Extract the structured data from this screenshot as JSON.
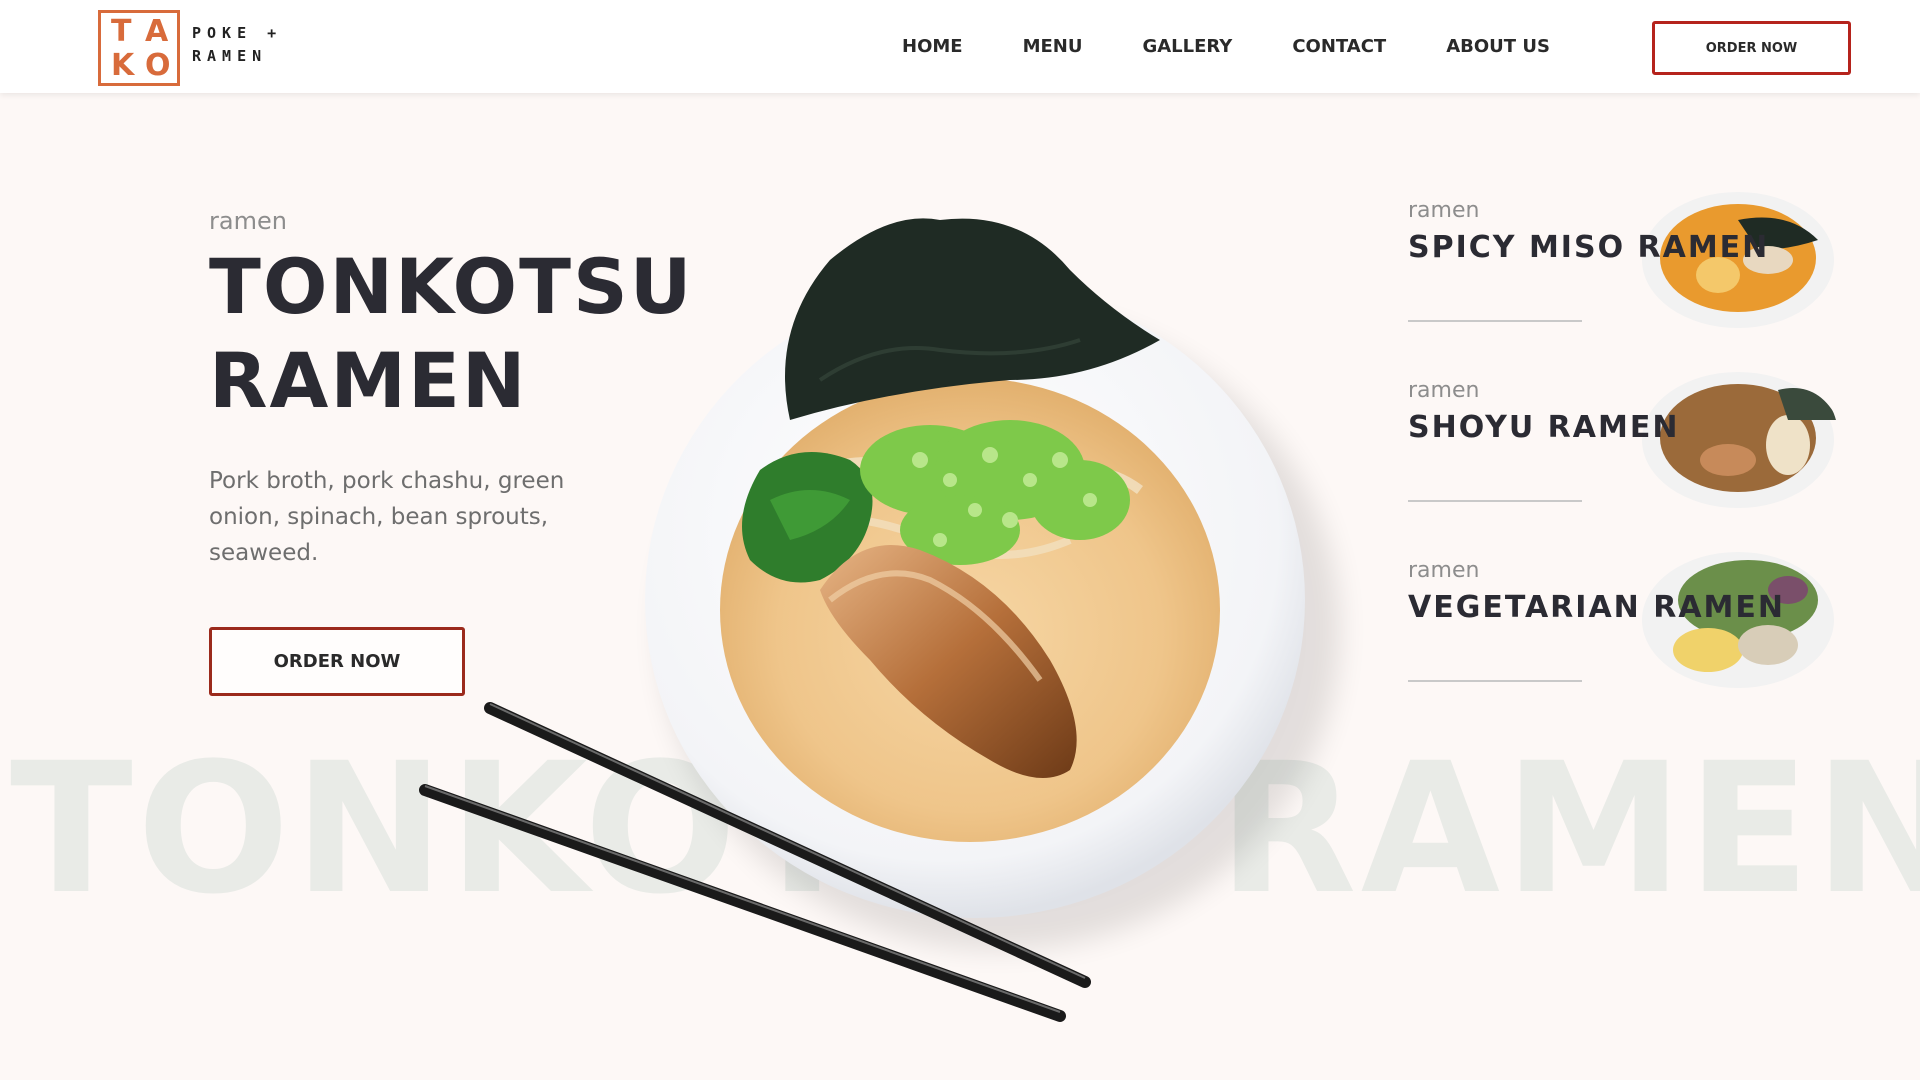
{
  "brand": {
    "logo_letters": [
      "T",
      "A",
      "K",
      "O"
    ],
    "tagline_line1": "POKE +",
    "tagline_line2": "RAMEN",
    "accent_color": "#d86b3b"
  },
  "nav": {
    "items": [
      "HOME",
      "MENU",
      "GALLERY",
      "CONTACT",
      "ABOUT US"
    ],
    "order_button": "ORDER NOW"
  },
  "hero": {
    "category": "ramen",
    "title_line1": "TONKOTSU",
    "title_line2": "RAMEN",
    "description": "Pork broth, pork chashu, green onion, spinach, bean sprouts, seaweed.",
    "order_button": "ORDER NOW",
    "background_text": "TONKOTSU RAMEN",
    "button_border_color": "#9b2a1c"
  },
  "side_menu": [
    {
      "category": "ramen",
      "name": "SPICY MISO RAMEN"
    },
    {
      "category": "ramen",
      "name": "SHOYU RAMEN"
    },
    {
      "category": "ramen",
      "name": "VEGETARIAN RAMEN"
    }
  ],
  "icons": [
    "ramen-bowl-image",
    "chopsticks-image",
    "spicy-miso-ramen-image",
    "shoyu-ramen-image",
    "vegetarian-ramen-image"
  ]
}
